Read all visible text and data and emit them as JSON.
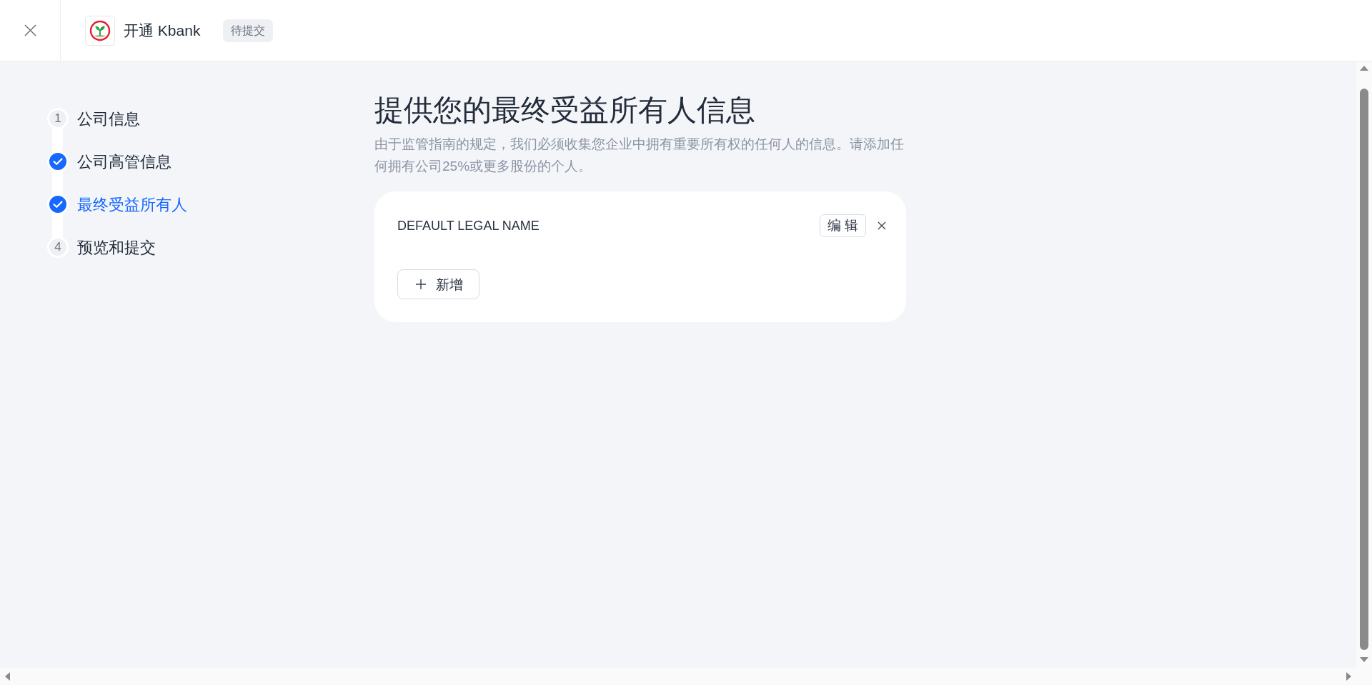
{
  "header": {
    "title": "开通 Kbank",
    "status_badge": "待提交"
  },
  "steps": [
    {
      "number": "1",
      "label": "公司信息",
      "completed": false,
      "selected": false
    },
    {
      "label": "公司高管信息",
      "completed": true,
      "selected": false
    },
    {
      "label": "最终受益所有人",
      "completed": true,
      "selected": true
    },
    {
      "number": "4",
      "label": "预览和提交",
      "completed": false,
      "selected": false
    }
  ],
  "page": {
    "title": "提供您的最终受益所有人信息",
    "description": "由于监管指南的规定，我们必须收集您企业中拥有重要所有权的任何人的信息。请添加任何拥有公司25%或更多股份的个人。"
  },
  "owners": [
    {
      "name": "DEFAULT LEGAL NAME",
      "edit_button": "编 辑"
    }
  ],
  "add_button": "新增"
}
